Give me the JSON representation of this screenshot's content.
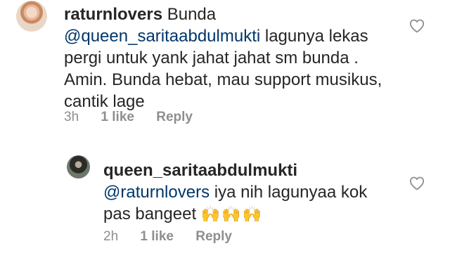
{
  "comments": [
    {
      "username": "raturnlovers",
      "text_lead": " Bunda",
      "mention": "@queen_saritaabdulmukti",
      "text": " lagunya lekas pergi untuk yank jahat jahat sm bunda . Amin. Bunda hebat, mau support musikus, cantik lage",
      "time": "3h",
      "likes": "1 like",
      "reply": "Reply"
    },
    {
      "username": "queen_saritaabdulmukti",
      "mention": "@raturnlovers",
      "text": " iya nih lagunyaa kok pas bangeet ",
      "emoji": "🙌🙌🙌",
      "time": "2h",
      "likes": "1 like",
      "reply": "Reply"
    }
  ],
  "icons": {
    "like": "heart-outline-icon"
  },
  "colors": {
    "text": "#262626",
    "mention": "#00376b",
    "meta": "#8e8e8e",
    "heart_stroke": "#8e8e8e"
  }
}
